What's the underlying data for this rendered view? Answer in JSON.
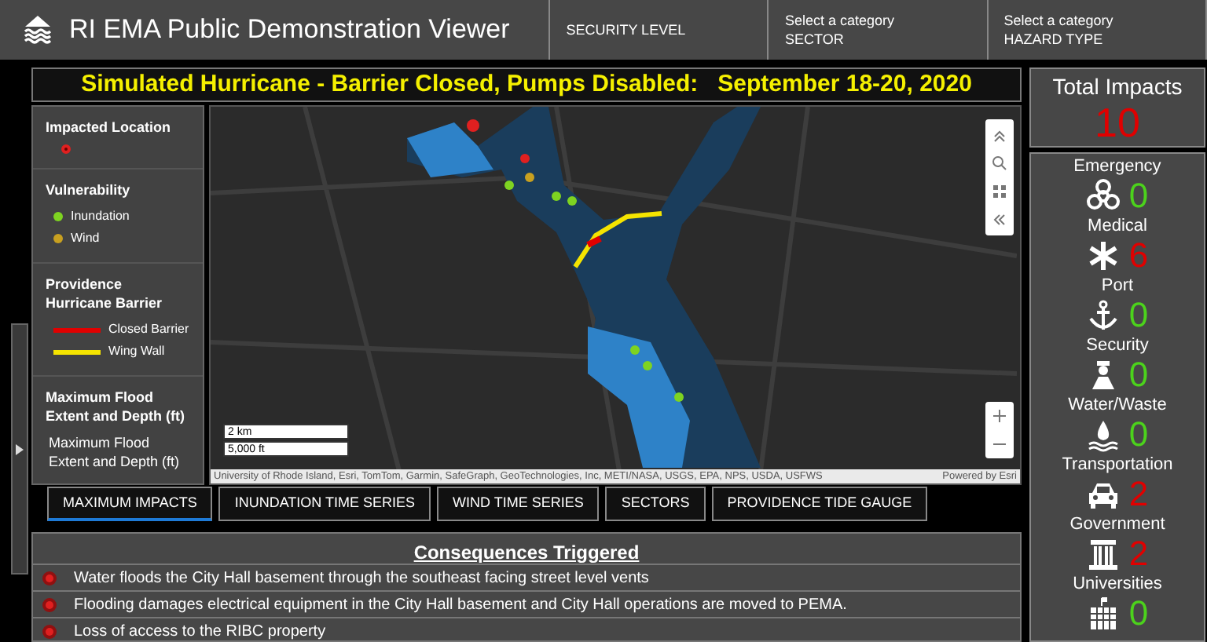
{
  "header": {
    "title": "RI EMA Public Demonstration Viewer",
    "filters": [
      {
        "label": "SECURITY LEVEL"
      },
      {
        "prompt": "Select a category",
        "label": "SECTOR"
      },
      {
        "prompt": "Select a category",
        "label": "HAZARD TYPE"
      }
    ]
  },
  "banner": "Simulated Hurricane - Barrier Closed, Pumps Disabled:   September 18-20, 2020",
  "legend": [
    {
      "title": "Impacted Location",
      "items": [
        {
          "kind": "marker",
          "color": "#e02020"
        }
      ]
    },
    {
      "title": "Vulnerability",
      "items": [
        {
          "kind": "dot",
          "label": "Inundation",
          "color": "#7ed321"
        },
        {
          "kind": "dot",
          "label": "Wind",
          "color": "#c8a020"
        }
      ]
    },
    {
      "title": "Providence Hurricane Barrier",
      "items": [
        {
          "kind": "line",
          "label": "Closed Barrier",
          "color": "#e00000"
        },
        {
          "kind": "line",
          "label": "Wing Wall",
          "color": "#f5e400"
        }
      ]
    },
    {
      "title": "Maximum Flood Extent and Depth (ft)",
      "items": [
        {
          "kind": "text",
          "label": "Maximum Flood Extent and Depth (ft)"
        }
      ]
    }
  ],
  "map": {
    "scale": [
      "2 km",
      "5,000 ft"
    ],
    "attribution": "University of Rhode Island, Esri, TomTom, Garmin, SafeGraph, GeoTechnologies, Inc, METI/NASA, USGS, EPA, NPS, USDA, USFWS",
    "powered_by": "Powered by Esri"
  },
  "tabs": [
    {
      "label": "MAXIMUM IMPACTS",
      "selected": true
    },
    {
      "label": "INUNDATION TIME SERIES",
      "selected": false
    },
    {
      "label": "WIND TIME SERIES",
      "selected": false
    },
    {
      "label": "SECTORS",
      "selected": false
    },
    {
      "label": "PROVIDENCE TIDE GAUGE",
      "selected": false
    }
  ],
  "consequences": {
    "title": "Consequences Triggered",
    "items": [
      "Water floods the City Hall basement through the southeast facing street level vents",
      "Flooding damages electrical equipment in the City Hall basement and City Hall operations are moved to PEMA.",
      "Loss of access to the RIBC property"
    ]
  },
  "total_impacts": {
    "title": "Total Impacts",
    "count": "10"
  },
  "sectors": [
    {
      "kind": "biohazard",
      "label": "Emergency",
      "count": "0",
      "color": "#4cd21c"
    },
    {
      "kind": "medical",
      "label": "Medical",
      "count": "6",
      "color": "#e00000"
    },
    {
      "kind": "anchor",
      "label": "Port",
      "count": "0",
      "color": "#4cd21c"
    },
    {
      "kind": "guard",
      "label": "Security",
      "count": "0",
      "color": "#4cd21c"
    },
    {
      "kind": "water",
      "label": "Water/Waste",
      "count": "0",
      "color": "#4cd21c"
    },
    {
      "kind": "car",
      "label": "Transportation",
      "count": "2",
      "color": "#e00000"
    },
    {
      "kind": "columns",
      "label": "Government",
      "count": "2",
      "color": "#e00000"
    },
    {
      "kind": "school",
      "label": "Universities",
      "count": "0",
      "color": "#4cd21c"
    }
  ]
}
